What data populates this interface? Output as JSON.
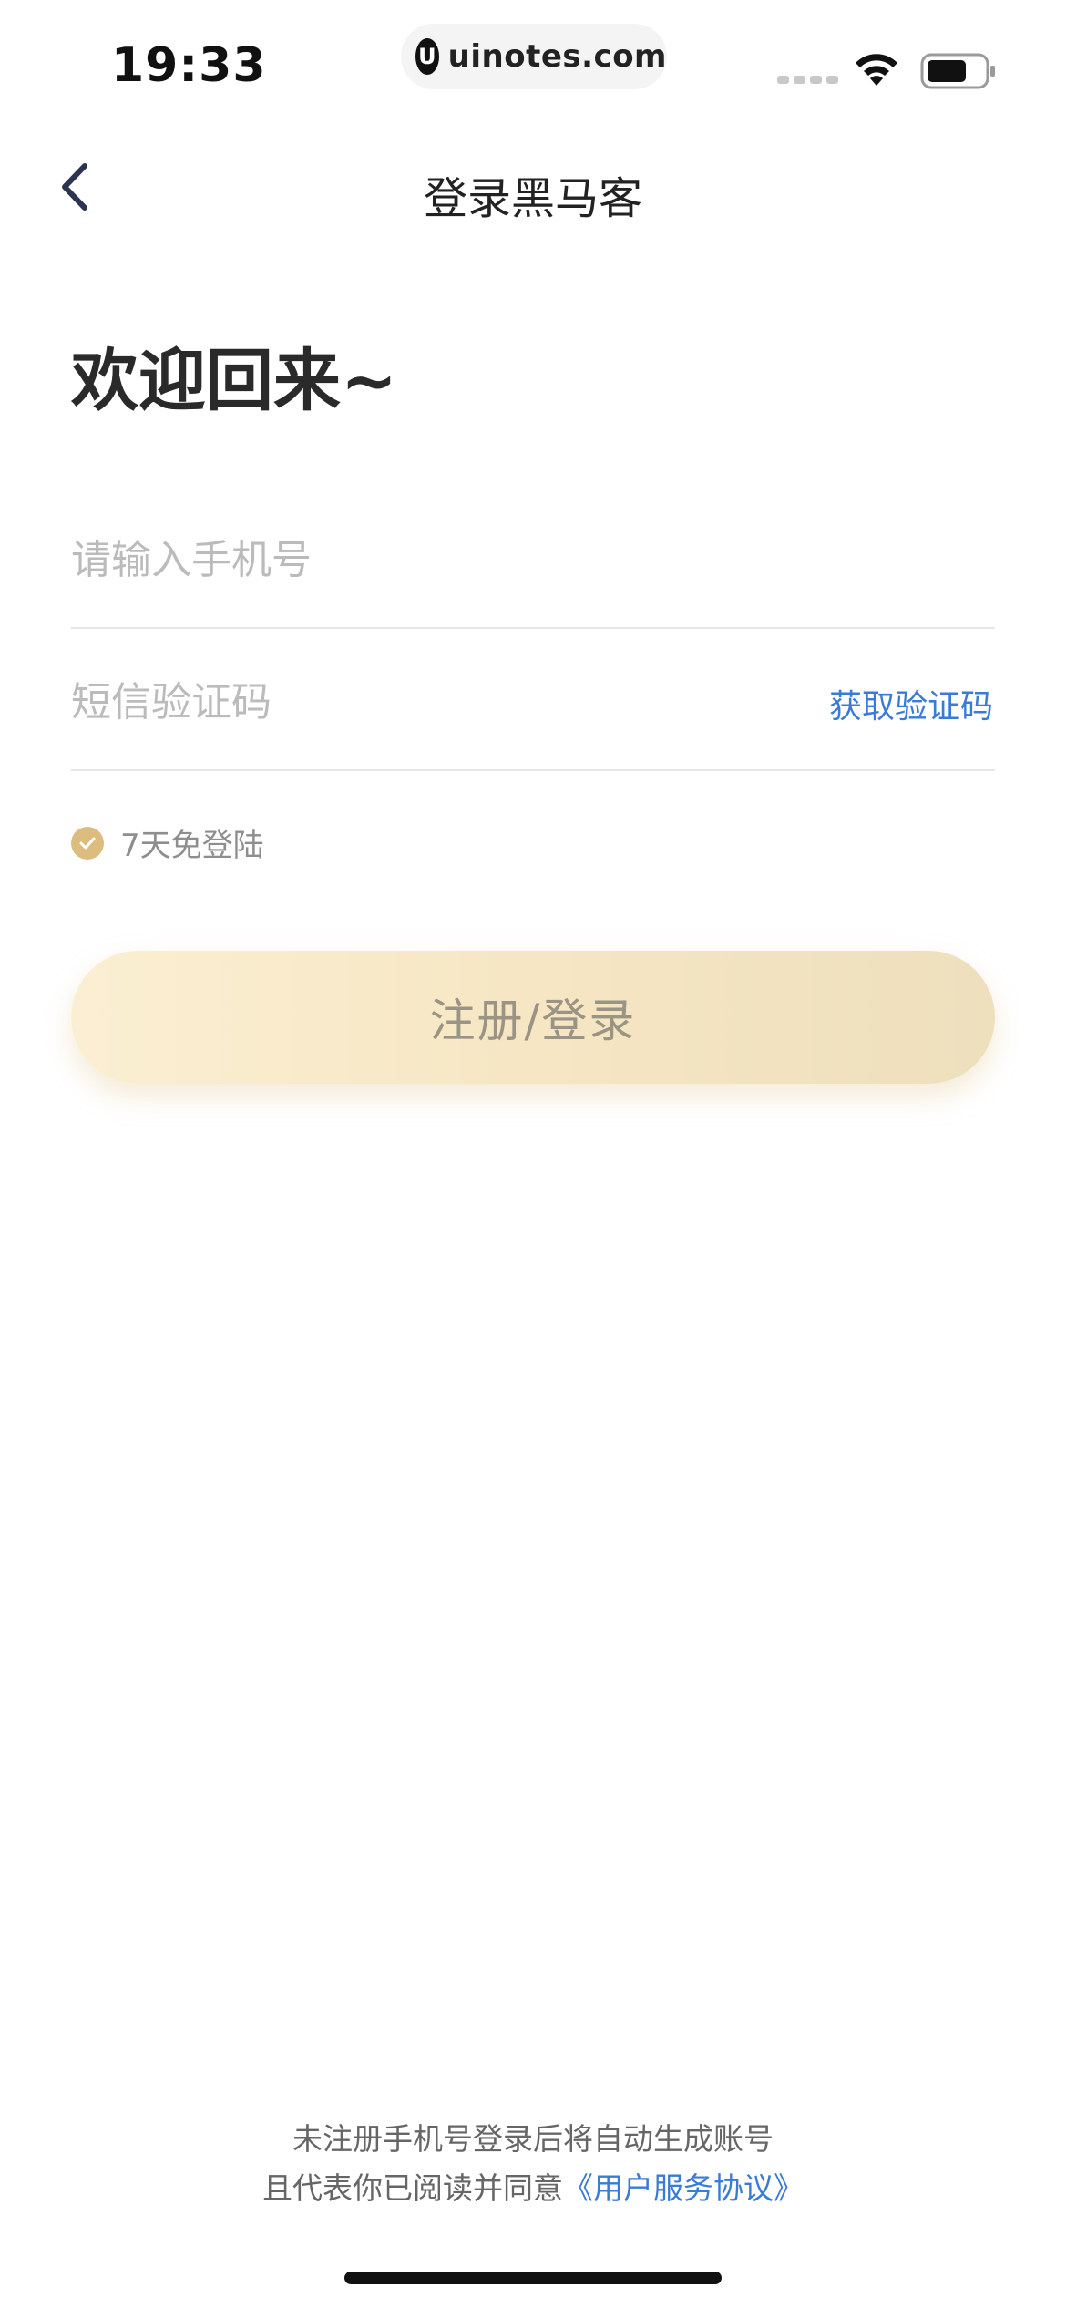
{
  "status_bar": {
    "time": "19:33",
    "url_logo": "U",
    "url": "uinotes.com"
  },
  "nav": {
    "title": "登录黑马客"
  },
  "welcome": "欢迎回来~",
  "form": {
    "phone_placeholder": "请输入手机号",
    "phone_value": "",
    "code_placeholder": "短信验证码",
    "code_value": "",
    "get_code_label": "获取验证码",
    "remember_label": "7天免登陆",
    "remember_checked": true,
    "submit_label": "注册/登录"
  },
  "footer": {
    "line1": "未注册手机号登录后将自动生成账号",
    "line2_prefix": "且代表你已阅读并同意",
    "agreement_link": "《用户服务协议》"
  },
  "colors": {
    "accent_link": "#3a7bd5",
    "check_gold": "#dcbd7f",
    "button_gradient_start": "#fbefd3",
    "button_gradient_end": "#eedfbd",
    "button_text": "#9a9484"
  },
  "icons": {
    "back": "chevron-left-icon",
    "wifi": "wifi-icon",
    "battery": "battery-icon",
    "check": "check-icon",
    "signal": "signal-dots-icon"
  }
}
